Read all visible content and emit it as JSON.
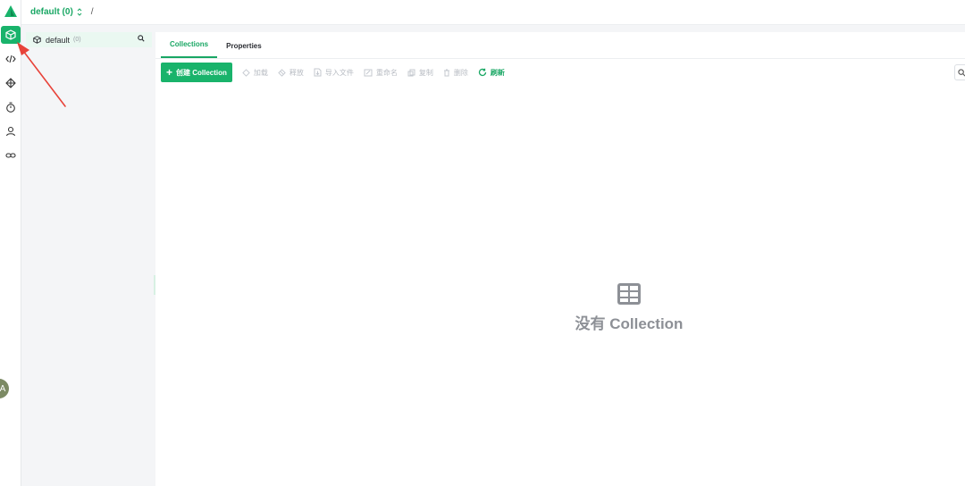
{
  "topbar": {
    "database": "default (0)",
    "separator": "/"
  },
  "rail": {
    "items": [
      {
        "name": "collections-icon",
        "active": true
      },
      {
        "name": "code-icon"
      },
      {
        "name": "graph-icon"
      },
      {
        "name": "timer-icon"
      },
      {
        "name": "user-icon"
      },
      {
        "name": "link-icon"
      }
    ],
    "avatar": "A"
  },
  "collection_list": {
    "items": [
      {
        "label": "default",
        "count": "(0)"
      }
    ]
  },
  "tabs": [
    {
      "label": "Collections",
      "active": true
    },
    {
      "label": "Properties",
      "active": false
    }
  ],
  "toolbar": {
    "create_label": "创建 Collection",
    "actions": [
      {
        "label": "加载",
        "icon": "load-icon",
        "enabled": false
      },
      {
        "label": "释放",
        "icon": "release-icon",
        "enabled": false
      },
      {
        "label": "导入文件",
        "icon": "import-icon",
        "enabled": false
      },
      {
        "label": "重命名",
        "icon": "rename-icon",
        "enabled": false
      },
      {
        "label": "复制",
        "icon": "copy-icon",
        "enabled": false
      },
      {
        "label": "删除",
        "icon": "delete-icon",
        "enabled": false
      },
      {
        "label": "刷新",
        "icon": "refresh-icon",
        "enabled": true
      }
    ]
  },
  "empty_state": {
    "message": "没有 Collection"
  },
  "colors": {
    "accent": "#19b36b",
    "disabled": "#b8bcc3",
    "annotation": "#e8433a"
  }
}
